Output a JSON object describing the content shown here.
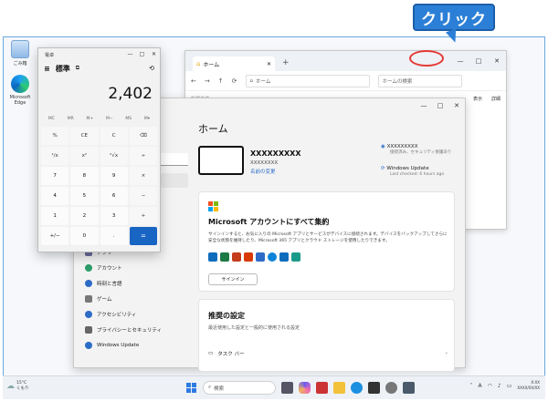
{
  "callout": {
    "text": "クリック",
    "color": "#2b7fd6"
  },
  "desktop_icons": [
    {
      "label": "ごみ箱",
      "icon": "recycle-bin-icon"
    },
    {
      "label": "Microsoft Edge",
      "icon": "edge-icon"
    }
  ],
  "explorer": {
    "tab": "ホーム",
    "plus": "+",
    "address": "ホーム",
    "search_placeholder": "ホームの検索",
    "toolbar": [
      "新規作成",
      "表示",
      "詳細"
    ],
    "win_buttons": [
      "—",
      "□",
      "✕"
    ]
  },
  "calculator": {
    "title": "電卓",
    "mode": "標準",
    "display": "2,402",
    "memory": [
      "MC",
      "MR",
      "M+",
      "M−",
      "MS",
      "M▾"
    ],
    "buttons": [
      "%",
      "CE",
      "C",
      "⌫",
      "¹/x",
      "x²",
      "²√x",
      "÷",
      "7",
      "8",
      "9",
      "×",
      "4",
      "5",
      "6",
      "−",
      "1",
      "2",
      "3",
      "+",
      "+/−",
      "0",
      ".",
      "="
    ],
    "win_buttons": [
      "—",
      "□",
      "✕"
    ]
  },
  "settings": {
    "title": "ホーム",
    "account": {
      "name": "XXXXXXXXX",
      "email": "XXXXXXXX",
      "link": "名前の変更"
    },
    "network": {
      "name": "XXXXXXXXX",
      "status": "接続済み、セキュリティ保護あり"
    },
    "update": {
      "title": "Windows Update",
      "status": "Last checked: 6 hours ago"
    },
    "card1": {
      "title": "Microsoft アカウントにすべて集約",
      "desc": "サインインすると、お気に入りの Microsoft アプリとサービスがデバイスに接続されます。デバイスをバックアップしてさらに安全な状態を維持したり、Microsoft 365 アプリとクラウド ストレージを使用したりできます。",
      "button": "サインイン"
    },
    "card2": {
      "title": "推奨の設定",
      "desc": "最近使用した設定と一般的に使用される設定",
      "row": "タスク バー"
    },
    "sidebar": [
      {
        "label": "アプリ",
        "color": "#6b6b9c"
      },
      {
        "label": "アカウント",
        "color": "#2d9c6a"
      },
      {
        "label": "時刻と言語",
        "color": "#2d6cc6"
      },
      {
        "label": "ゲーム",
        "color": "#777"
      },
      {
        "label": "アクセシビリティ",
        "color": "#2d6cc6"
      },
      {
        "label": "プライバシーとセキュリティ",
        "color": "#666"
      },
      {
        "label": "Windows Update",
        "color": "#2d6cc6"
      }
    ],
    "win_buttons": [
      "—",
      "□",
      "✕"
    ]
  },
  "taskbar": {
    "weather_temp": "15°C",
    "weather_desc": "くもり",
    "search": "検索",
    "clock_time": "X:XX",
    "clock_date": "XXXX/XX/XX"
  }
}
